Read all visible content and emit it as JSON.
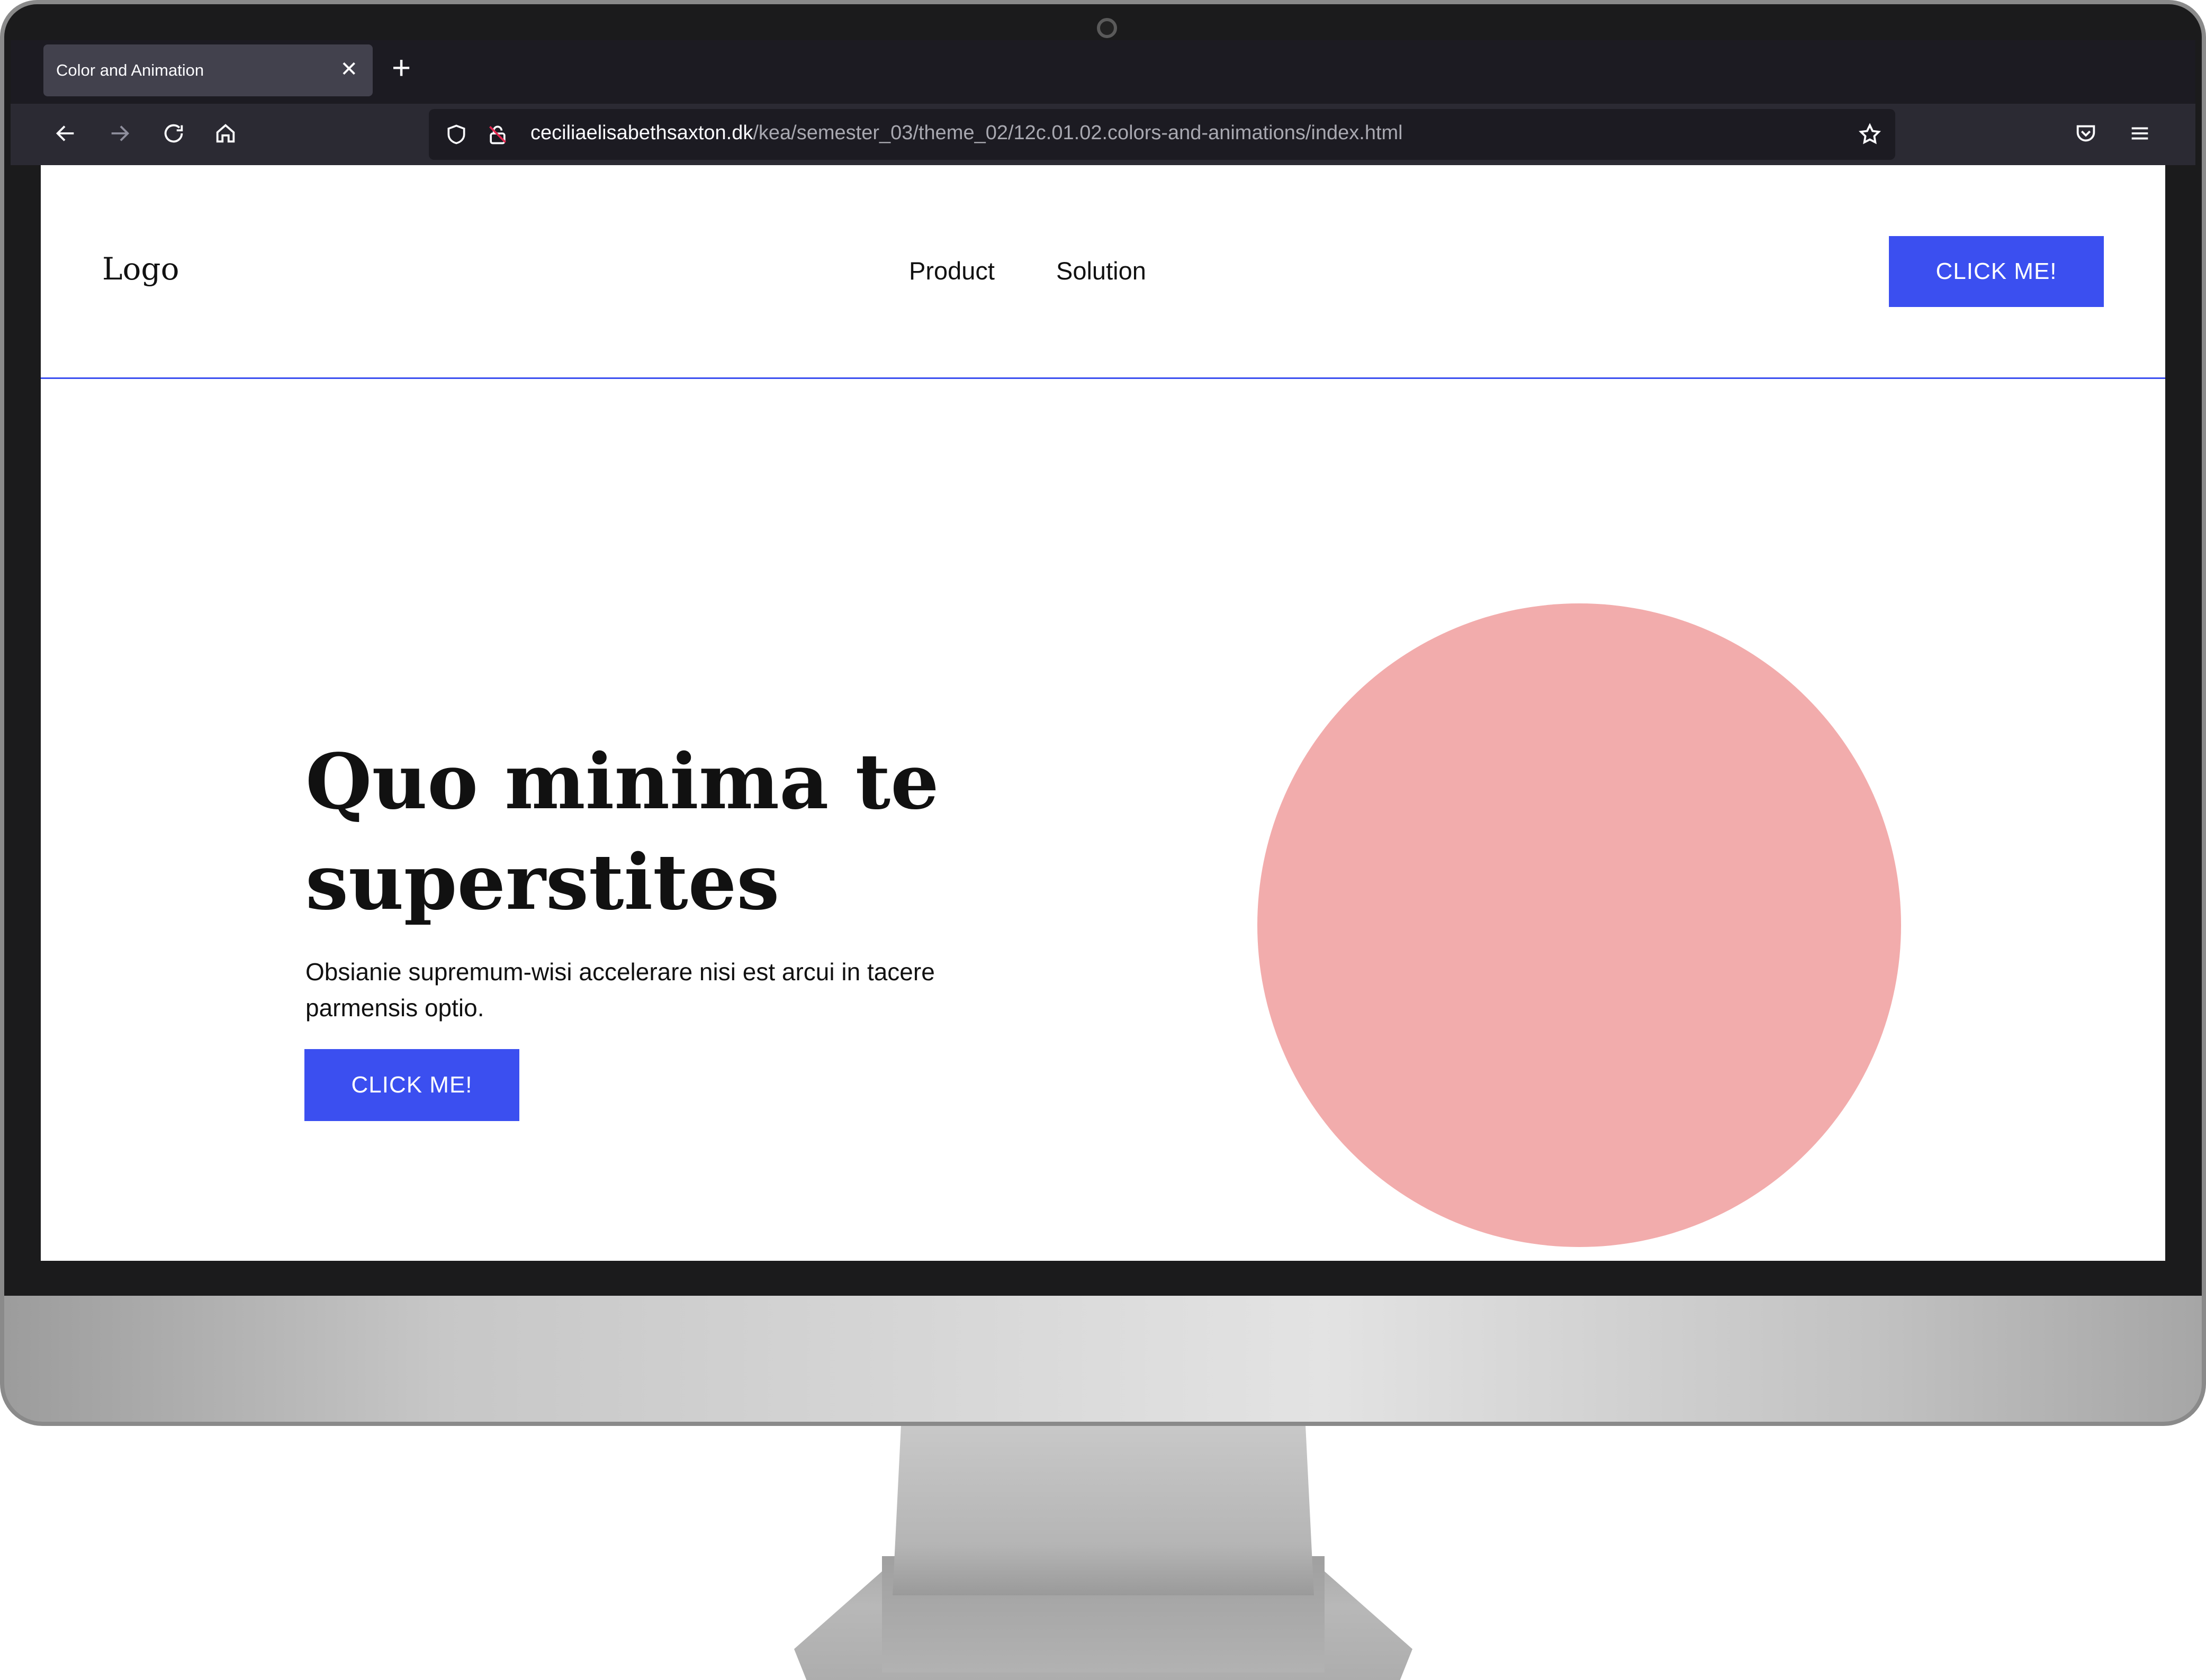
{
  "browser": {
    "tab_title": "Color and Animation",
    "tab_close_icon": "close-icon",
    "new_tab_icon": "plus-icon",
    "url_domain": "ceciliaelisabethsaxton.dk",
    "url_path": "/kea/semester_03/theme_02/12c.01.02.colors-and-animations/index.html",
    "nav_icons": [
      "back-arrow-icon",
      "forward-arrow-icon",
      "reload-icon",
      "home-icon"
    ],
    "right_icons": [
      "bookmark-star-icon",
      "pocket-icon",
      "hamburger-menu-icon"
    ]
  },
  "site": {
    "logo": "Logo",
    "nav": [
      "Product",
      "Solution"
    ],
    "header_cta": "CLICK ME!",
    "hero_title": "Quo minima te superstites",
    "hero_text": "Obsianie supremum-wisi accelerare nisi est arcui in tacere parmensis optio.",
    "hero_cta": "CLICK ME!",
    "accent_color": "#3b4ff0",
    "circle_color": "#f2acac"
  }
}
